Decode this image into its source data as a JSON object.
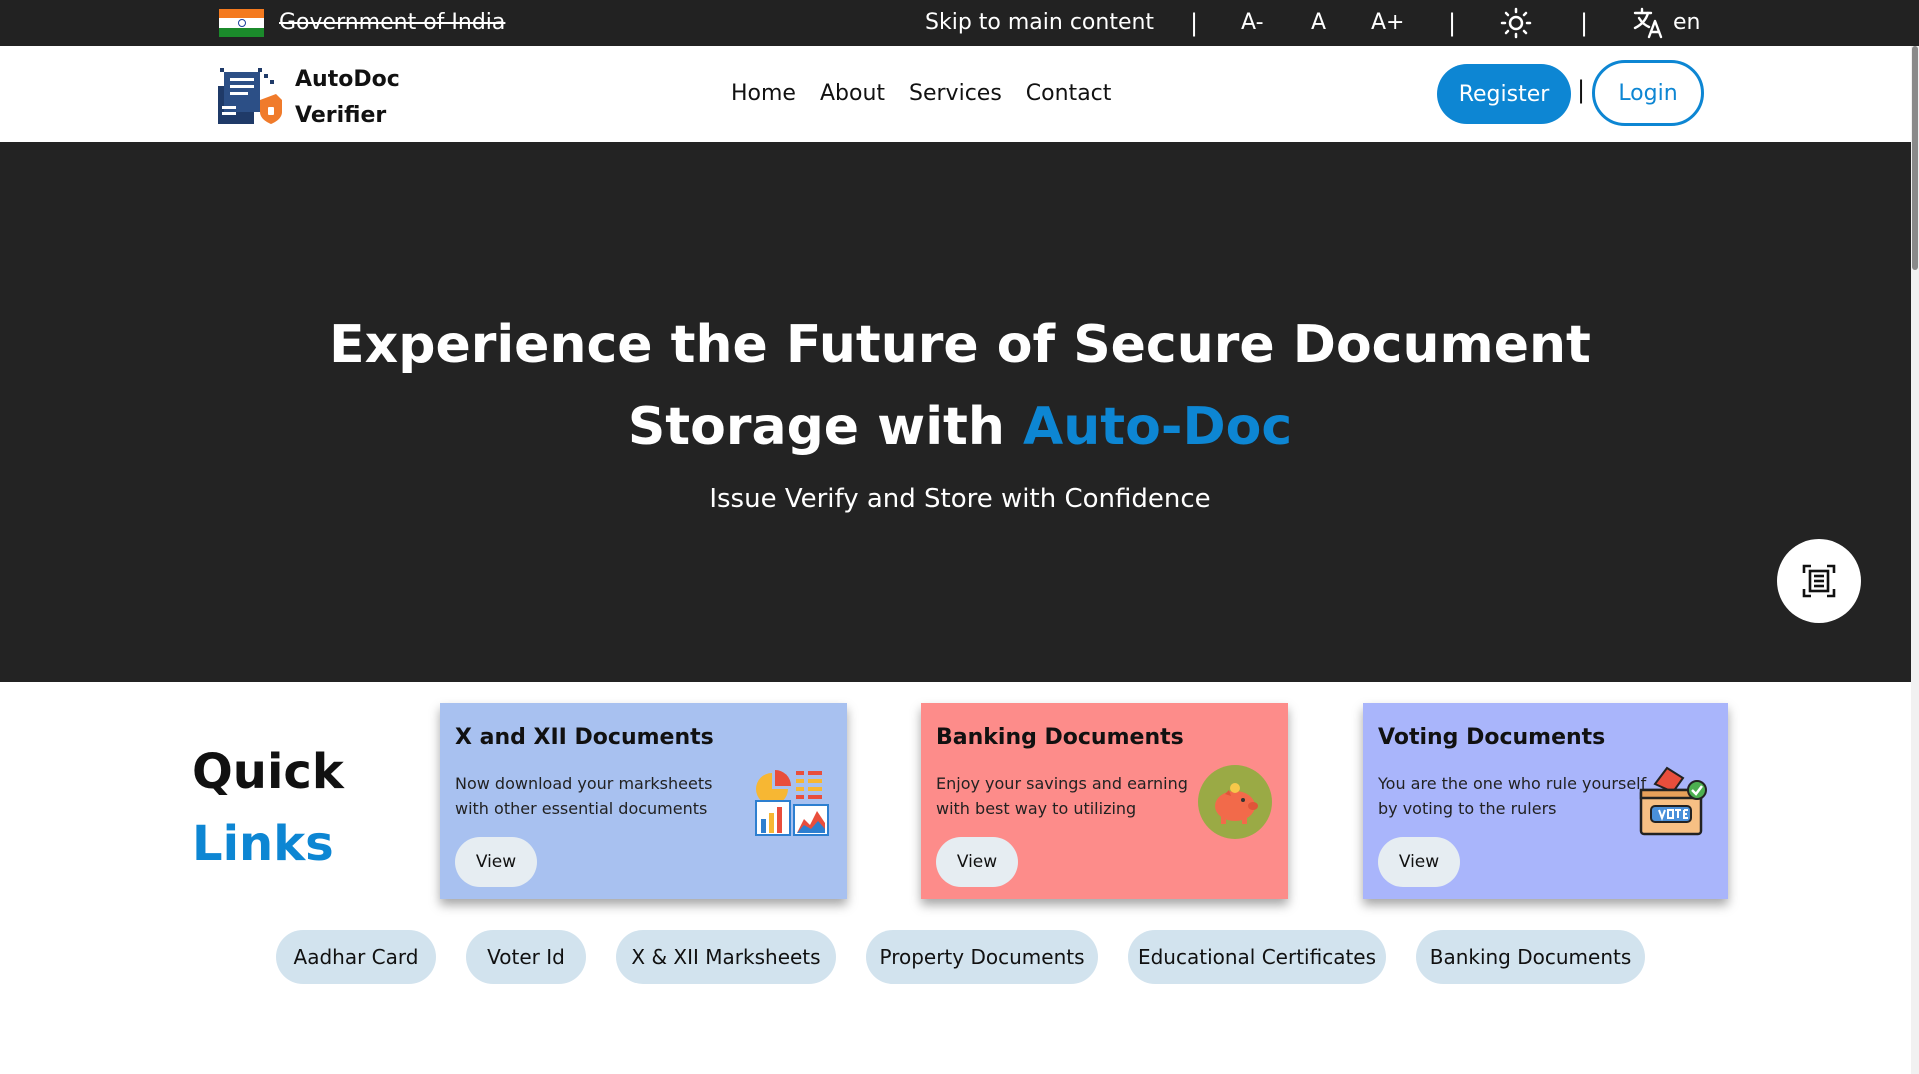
{
  "topbar": {
    "gov_label": "Government of India",
    "skip_label": "Skip to main content",
    "separator": "|",
    "font_decrease": "A-",
    "font_normal": "A",
    "font_increase": "A+",
    "language": "en",
    "icons": [
      "india-flag-icon",
      "theme-sun-icon",
      "translate-icon"
    ]
  },
  "header": {
    "brand_line1": "AutoDoc",
    "brand_line2": "Verifier",
    "nav": [
      "Home",
      "About",
      "Services",
      "Contact"
    ],
    "register_label": "Register",
    "separator": "|",
    "login_label": "Login",
    "accent_color": "#0d86d3"
  },
  "hero": {
    "title_line1": "Experience the Future of Secure Document",
    "title_line2_prefix": "Storage with ",
    "title_accent": "Auto-Doc",
    "subtitle": "Issue Verify and Store with Confidence",
    "scan_button_icon": "scan-document-icon"
  },
  "quick_links": {
    "heading_line1": "Quick",
    "heading_line2": "Links",
    "cards": [
      {
        "title": "X and XII Documents",
        "description": "Now download your marksheets with other essential documents",
        "button": "View",
        "icon": "charts-report-icon",
        "color": "#a8c1f0"
      },
      {
        "title": "Banking Documents",
        "description": "Enjoy your savings and earning with best way to utilizing",
        "button": "View",
        "icon": "piggy-bank-icon",
        "color": "#fd8c8a"
      },
      {
        "title": "Voting Documents",
        "description": "You are the one who rule yourself by voting to the rulers",
        "button": "View",
        "icon": "ballot-box-icon",
        "color": "#a9b5fb"
      }
    ],
    "chips": [
      "Aadhar Card",
      "Voter Id",
      "X & XII Marksheets",
      "Property Documents",
      "Educational Certificates",
      "Banking Documents"
    ]
  }
}
